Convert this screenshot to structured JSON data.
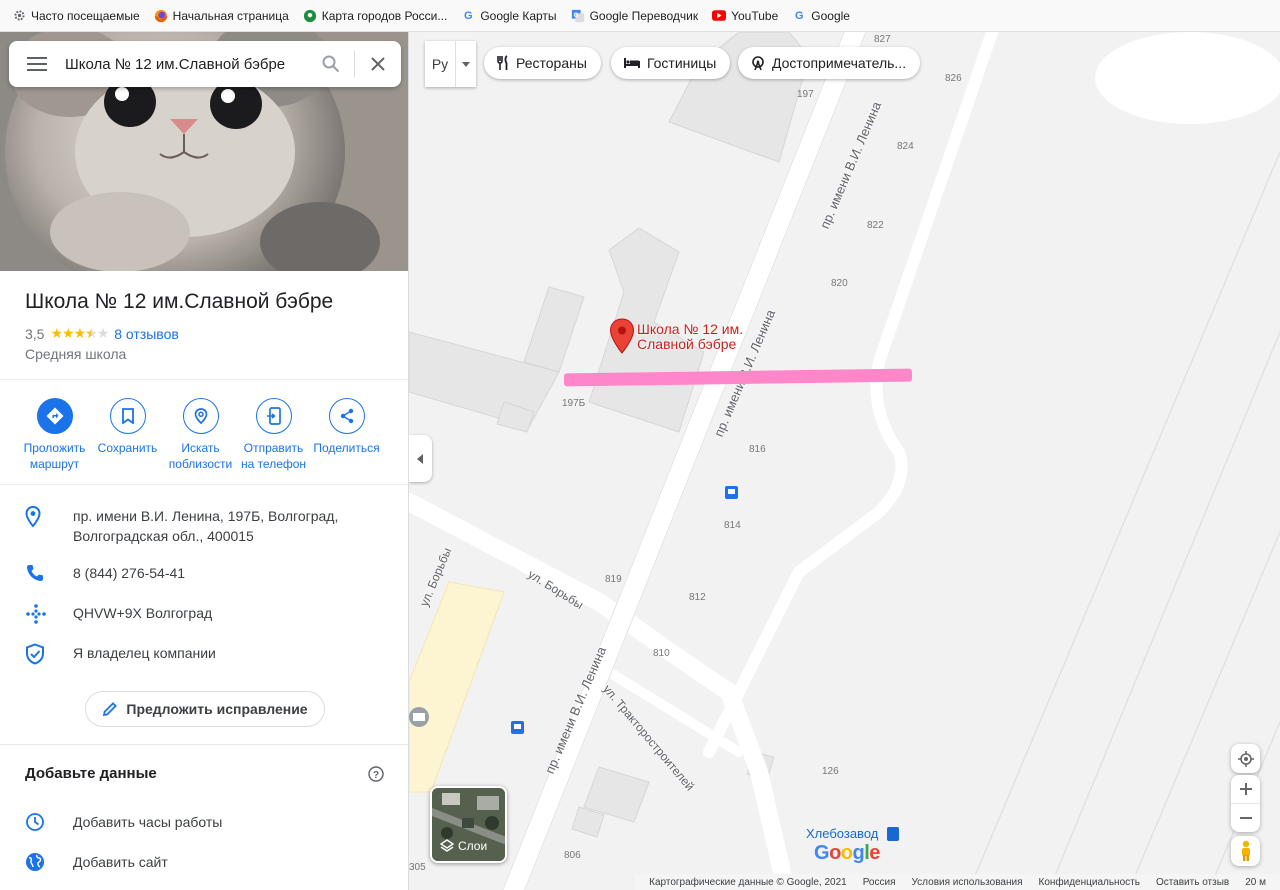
{
  "bookmarks": [
    {
      "label": "Часто посещаемые",
      "icon": "gear-icon",
      "color": "#5f6368"
    },
    {
      "label": "Начальная страница",
      "icon": "firefox-icon",
      "color": "#e66000"
    },
    {
      "label": "Карта городов Росси...",
      "icon": "map-pin-icon",
      "color": "#1e8e3e"
    },
    {
      "label": "Google Карты",
      "icon": "google-icon",
      "color": "#4285f4"
    },
    {
      "label": "Google Переводчик",
      "icon": "translate-icon",
      "color": "#4285f4"
    },
    {
      "label": "YouTube",
      "icon": "youtube-icon",
      "color": "#ff0000"
    },
    {
      "label": "Google",
      "icon": "google-icon",
      "color": "#4285f4"
    }
  ],
  "search": {
    "query": "Школа № 12 им.Славной бэбре"
  },
  "place": {
    "title": "Школа № 12 им.Славной бэбре",
    "rating": "3,5",
    "stars": 3.5,
    "reviews": "8 отзывов",
    "category": "Средняя школа"
  },
  "actions": [
    {
      "label": "Проложить маршрут",
      "icon": "directions-icon"
    },
    {
      "label": "Сохранить",
      "icon": "bookmark-icon"
    },
    {
      "label": "Искать поблизости",
      "icon": "nearby-icon"
    },
    {
      "label": "Отправить на телефон",
      "icon": "send-to-phone-icon"
    },
    {
      "label": "Поделиться",
      "icon": "share-icon"
    }
  ],
  "info": {
    "address_line1": "пр. имени В.И. Ленина, 197Б, Волгоград,",
    "address_line2": "Волгоградская обл., 400015",
    "phone": "8 (844) 276-54-41",
    "plus_code": "QHVW+9X Волгоград",
    "owner": "Я владелец компании"
  },
  "suggest_edit": "Предложить исправление",
  "add_data": {
    "title": "Добавьте данные",
    "items": [
      "Добавить часы работы",
      "Добавить сайт"
    ]
  },
  "map": {
    "lang": "Ру",
    "chips": [
      "Рестораны",
      "Гостиницы",
      "Достопримечатель..."
    ],
    "marker_label_line1": "Школа № 12 им.",
    "marker_label_line2": "Славной бэбре",
    "streets": [
      "пр. имени В.И. Ленина",
      "пр. имени В.И. Ленина",
      "ул. Борьбы",
      "ул. Борьбы",
      "ул. Тракторостроителей",
      "пр. имени В.И. Ленина"
    ],
    "house_numbers": [
      "827",
      "826",
      "197",
      "824",
      "822",
      "820",
      "197Б",
      "816",
      "814",
      "819",
      "812",
      "810",
      "126",
      "806",
      "305"
    ],
    "layers_label": "Слои",
    "poi": "Хлебозавод",
    "footer": [
      "Картографические данные © Google, 2021",
      "Россия",
      "Условия использования",
      "Конфиденциальность",
      "Оставить отзыв",
      "20 м"
    ]
  },
  "colors": {
    "accent": "#1a73e8",
    "marker": "#ea4335",
    "highlight": "#ff86c8",
    "star": "#fbbc04"
  }
}
